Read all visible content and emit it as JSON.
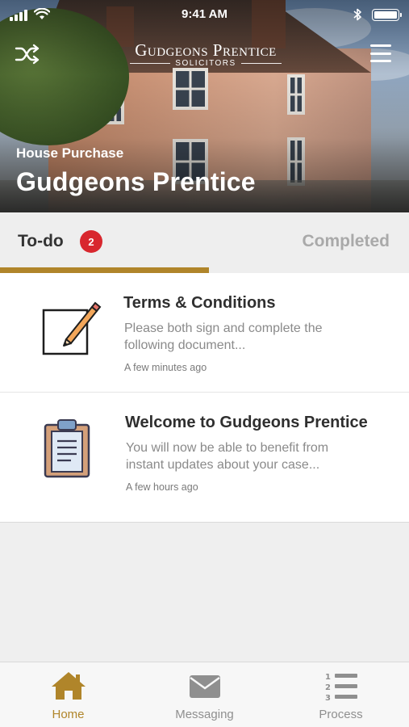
{
  "status_bar": {
    "time": "9:41 AM"
  },
  "header": {
    "logo_name": "Gudgeons Prentice",
    "logo_sub": "SOLICITORS",
    "case_type": "House Purchase",
    "case_title": "Gudgeons Prentice"
  },
  "tabs": {
    "todo_label": "To-do",
    "todo_count": "2",
    "completed_label": "Completed",
    "active": "To-do"
  },
  "tasks": [
    {
      "icon": "pencil-edit-icon",
      "title": "Terms & Conditions",
      "description": "Please both sign and complete the following document...",
      "time": "A few minutes ago"
    },
    {
      "icon": "clipboard-icon",
      "title": "Welcome to Gudgeons Prentice",
      "description": "You will now be able to benefit from instant updates about your case...",
      "time": "A few hours ago"
    }
  ],
  "bottom_nav": [
    {
      "label": "Home",
      "icon": "home-icon",
      "active": true
    },
    {
      "label": "Messaging",
      "icon": "envelope-icon",
      "active": false
    },
    {
      "label": "Process",
      "icon": "numbered-list-icon",
      "active": false
    }
  ],
  "colors": {
    "accent": "#b0852a",
    "badge": "#d8272e",
    "inactive": "#8f8f8f"
  }
}
